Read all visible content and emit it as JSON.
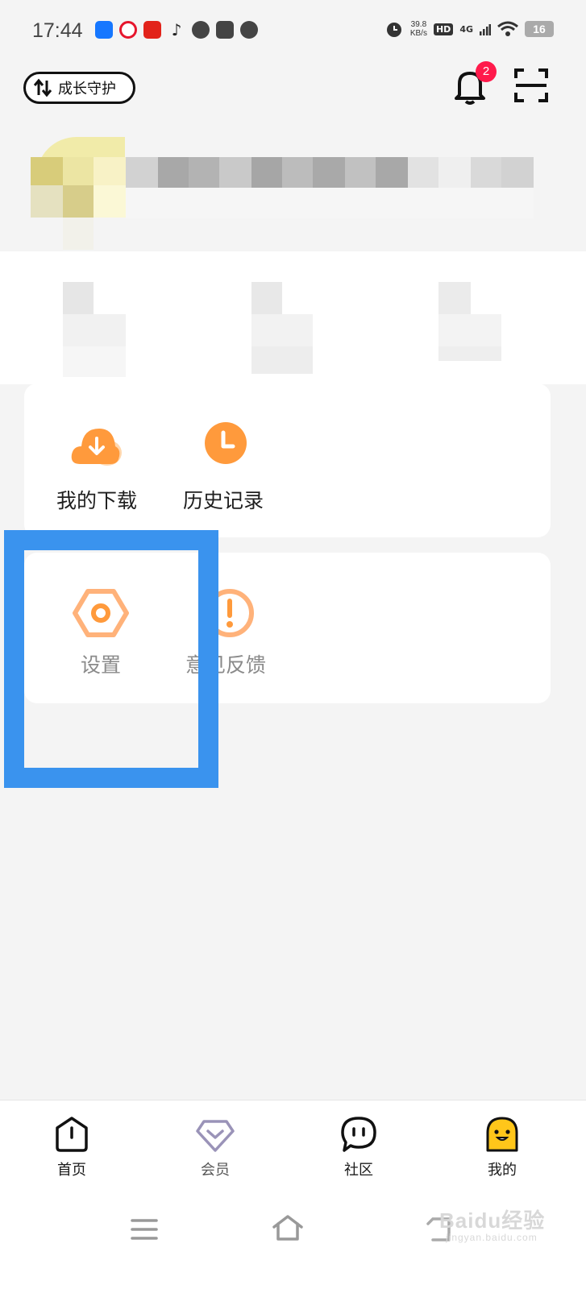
{
  "status_bar": {
    "time": "17:44",
    "net_speed_value": "39.8",
    "net_speed_unit": "KB/s",
    "hd_label": "HD",
    "network_type": "4G",
    "battery_level": "16",
    "notification_icons": [
      "alipay-icon",
      "weibo-icon",
      "app-red-icon",
      "tiktok-icon",
      "speedometer-icon",
      "mail-icon",
      "chat-icon"
    ]
  },
  "header": {
    "growth_guard_label": "成长守护",
    "notification_count": "2"
  },
  "menu": {
    "card1": [
      {
        "label": "我的下载",
        "icon": "download-cloud-icon"
      },
      {
        "label": "历史记录",
        "icon": "history-clock-icon"
      }
    ],
    "card2": [
      {
        "label": "设置",
        "icon": "settings-hex-icon"
      },
      {
        "label": "意见反馈",
        "icon": "feedback-exclamation-icon"
      }
    ]
  },
  "bottom_nav": [
    {
      "label": "首页",
      "icon": "home-power-icon"
    },
    {
      "label": "会员",
      "icon": "vip-diamond-icon"
    },
    {
      "label": "社区",
      "icon": "community-chat-icon"
    },
    {
      "label": "我的",
      "icon": "profile-chick-icon",
      "active": true
    }
  ],
  "watermark": {
    "brand": "Baidu经验",
    "url": "jingyan.baidu.com"
  },
  "colors": {
    "accent_orange": "#ff9a3c",
    "highlight_blue": "#3a93ee",
    "badge_red": "#ff1a4b",
    "active_yellow": "#ffc61a"
  }
}
